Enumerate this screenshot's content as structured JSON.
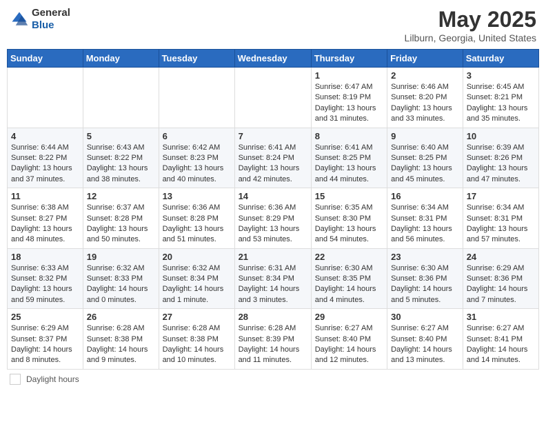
{
  "header": {
    "logo_line1": "General",
    "logo_line2": "Blue",
    "month_year": "May 2025",
    "location": "Lilburn, Georgia, United States"
  },
  "days_of_week": [
    "Sunday",
    "Monday",
    "Tuesday",
    "Wednesday",
    "Thursday",
    "Friday",
    "Saturday"
  ],
  "weeks": [
    [
      {
        "day": "",
        "sunrise": "",
        "sunset": "",
        "daylight": ""
      },
      {
        "day": "",
        "sunrise": "",
        "sunset": "",
        "daylight": ""
      },
      {
        "day": "",
        "sunrise": "",
        "sunset": "",
        "daylight": ""
      },
      {
        "day": "",
        "sunrise": "",
        "sunset": "",
        "daylight": ""
      },
      {
        "day": "1",
        "sunrise": "6:47 AM",
        "sunset": "8:19 PM",
        "daylight": "13 hours and 31 minutes."
      },
      {
        "day": "2",
        "sunrise": "6:46 AM",
        "sunset": "8:20 PM",
        "daylight": "13 hours and 33 minutes."
      },
      {
        "day": "3",
        "sunrise": "6:45 AM",
        "sunset": "8:21 PM",
        "daylight": "13 hours and 35 minutes."
      }
    ],
    [
      {
        "day": "4",
        "sunrise": "6:44 AM",
        "sunset": "8:22 PM",
        "daylight": "13 hours and 37 minutes."
      },
      {
        "day": "5",
        "sunrise": "6:43 AM",
        "sunset": "8:22 PM",
        "daylight": "13 hours and 38 minutes."
      },
      {
        "day": "6",
        "sunrise": "6:42 AM",
        "sunset": "8:23 PM",
        "daylight": "13 hours and 40 minutes."
      },
      {
        "day": "7",
        "sunrise": "6:41 AM",
        "sunset": "8:24 PM",
        "daylight": "13 hours and 42 minutes."
      },
      {
        "day": "8",
        "sunrise": "6:41 AM",
        "sunset": "8:25 PM",
        "daylight": "13 hours and 44 minutes."
      },
      {
        "day": "9",
        "sunrise": "6:40 AM",
        "sunset": "8:25 PM",
        "daylight": "13 hours and 45 minutes."
      },
      {
        "day": "10",
        "sunrise": "6:39 AM",
        "sunset": "8:26 PM",
        "daylight": "13 hours and 47 minutes."
      }
    ],
    [
      {
        "day": "11",
        "sunrise": "6:38 AM",
        "sunset": "8:27 PM",
        "daylight": "13 hours and 48 minutes."
      },
      {
        "day": "12",
        "sunrise": "6:37 AM",
        "sunset": "8:28 PM",
        "daylight": "13 hours and 50 minutes."
      },
      {
        "day": "13",
        "sunrise": "6:36 AM",
        "sunset": "8:28 PM",
        "daylight": "13 hours and 51 minutes."
      },
      {
        "day": "14",
        "sunrise": "6:36 AM",
        "sunset": "8:29 PM",
        "daylight": "13 hours and 53 minutes."
      },
      {
        "day": "15",
        "sunrise": "6:35 AM",
        "sunset": "8:30 PM",
        "daylight": "13 hours and 54 minutes."
      },
      {
        "day": "16",
        "sunrise": "6:34 AM",
        "sunset": "8:31 PM",
        "daylight": "13 hours and 56 minutes."
      },
      {
        "day": "17",
        "sunrise": "6:34 AM",
        "sunset": "8:31 PM",
        "daylight": "13 hours and 57 minutes."
      }
    ],
    [
      {
        "day": "18",
        "sunrise": "6:33 AM",
        "sunset": "8:32 PM",
        "daylight": "13 hours and 59 minutes."
      },
      {
        "day": "19",
        "sunrise": "6:32 AM",
        "sunset": "8:33 PM",
        "daylight": "14 hours and 0 minutes."
      },
      {
        "day": "20",
        "sunrise": "6:32 AM",
        "sunset": "8:34 PM",
        "daylight": "14 hours and 1 minute."
      },
      {
        "day": "21",
        "sunrise": "6:31 AM",
        "sunset": "8:34 PM",
        "daylight": "14 hours and 3 minutes."
      },
      {
        "day": "22",
        "sunrise": "6:30 AM",
        "sunset": "8:35 PM",
        "daylight": "14 hours and 4 minutes."
      },
      {
        "day": "23",
        "sunrise": "6:30 AM",
        "sunset": "8:36 PM",
        "daylight": "14 hours and 5 minutes."
      },
      {
        "day": "24",
        "sunrise": "6:29 AM",
        "sunset": "8:36 PM",
        "daylight": "14 hours and 7 minutes."
      }
    ],
    [
      {
        "day": "25",
        "sunrise": "6:29 AM",
        "sunset": "8:37 PM",
        "daylight": "14 hours and 8 minutes."
      },
      {
        "day": "26",
        "sunrise": "6:28 AM",
        "sunset": "8:38 PM",
        "daylight": "14 hours and 9 minutes."
      },
      {
        "day": "27",
        "sunrise": "6:28 AM",
        "sunset": "8:38 PM",
        "daylight": "14 hours and 10 minutes."
      },
      {
        "day": "28",
        "sunrise": "6:28 AM",
        "sunset": "8:39 PM",
        "daylight": "14 hours and 11 minutes."
      },
      {
        "day": "29",
        "sunrise": "6:27 AM",
        "sunset": "8:40 PM",
        "daylight": "14 hours and 12 minutes."
      },
      {
        "day": "30",
        "sunrise": "6:27 AM",
        "sunset": "8:40 PM",
        "daylight": "14 hours and 13 minutes."
      },
      {
        "day": "31",
        "sunrise": "6:27 AM",
        "sunset": "8:41 PM",
        "daylight": "14 hours and 14 minutes."
      }
    ]
  ],
  "footer": {
    "daylight_label": "Daylight hours"
  }
}
